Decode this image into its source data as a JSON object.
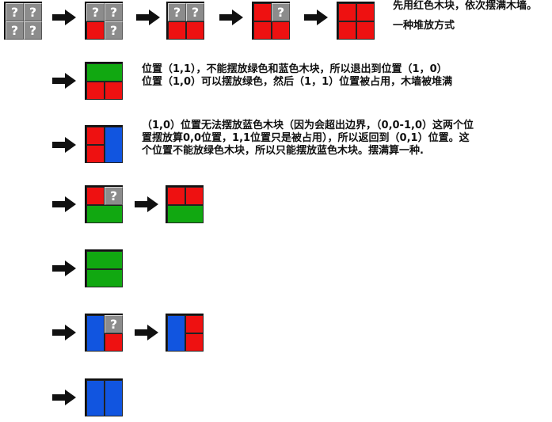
{
  "symbols": {
    "unknown_cell": "?"
  },
  "legend": {
    "red_rule": "先用红色木块，依次摆满木墙。",
    "one_way": "一种堆放方式"
  },
  "notes": {
    "step2": "位置（1,1），不能摆放绿色和蓝色木块，所以退出到位置（1，0）\n位置（1,0）可以摆放绿色，然后（1，1）位置被占用，木墙被堆满",
    "step3": "（1,0）位置无法摆放蓝色木块（因为会超出边界，（0,0-1,0）这两个位\n置摆放算0,0位置，1,1位置只是被占用），所以返回到（0,1）位置。这\n个位置不能放绿色木块，所以只能摆放蓝色木块。摆满算一种."
  },
  "colors": {
    "red": "#ee1111",
    "green": "#11a811",
    "blue": "#1155e0",
    "unknown": "#8c8c8c"
  }
}
